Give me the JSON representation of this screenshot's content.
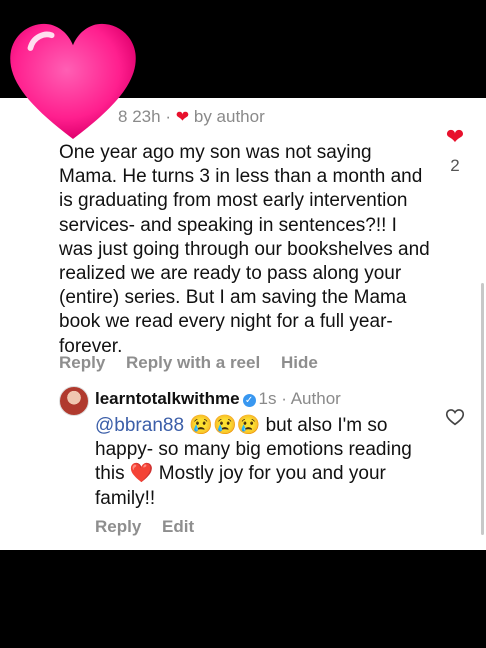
{
  "comment": {
    "meta_username_tail": "8",
    "time": "23h",
    "separator": "·",
    "by_author": "by author",
    "text": "One year ago my son was not saying Mama. He turns 3 in less than a month and is graduating from most early intervention services- and speaking in sentences?!! I was just going through our bookshelves and realized we are ready to pass along your (entire) series. But I am saving the Mama book we read every night for a full year- forever.",
    "like_count": "2",
    "actions": {
      "reply": "Reply",
      "reply_with_reel": "Reply with a reel",
      "hide": "Hide"
    }
  },
  "reply": {
    "username": "learntotalkwithme",
    "time": "1s",
    "separator": "·",
    "author_label": "Author",
    "mention": "@bbran88",
    "emojis": "😢😢😢",
    "text_part1": " but also I'm so happy- so many big emotions reading this ",
    "heart_emoji": "❤️",
    "text_part2": " Mostly joy for you and your family!!",
    "actions": {
      "reply": "Reply",
      "edit": "Edit"
    }
  },
  "colors": {
    "like_red": "#e8112d",
    "mention_blue": "#3b5ea8",
    "verified_blue": "#3897f0",
    "sticker_pink": "#ff1f8e"
  },
  "icons": {
    "sticker": "heart-sticker-icon",
    "like": "heart-icon",
    "verified": "verified-badge-icon"
  }
}
